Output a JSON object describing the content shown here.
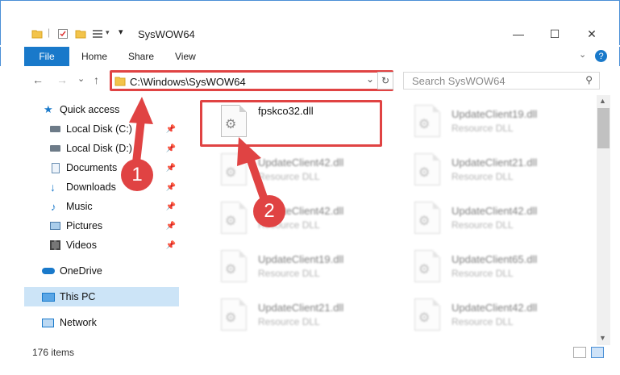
{
  "window": {
    "title": "SysWOW64"
  },
  "window_controls": {
    "minimize": "—",
    "maximize": "☐",
    "close": "✕"
  },
  "ribbon": {
    "file_label": "File",
    "tabs": [
      "Home",
      "Share",
      "View"
    ]
  },
  "navigation": {
    "back": "←",
    "forward": "→",
    "recent": "⌄",
    "up": "↑"
  },
  "address": {
    "path": "C:\\Windows\\SysWOW64"
  },
  "search": {
    "placeholder": "Search SysWOW64"
  },
  "sidebar": {
    "items": [
      {
        "label": "Quick access",
        "icon": "star-icon"
      },
      {
        "label": "Local Disk (C:)",
        "icon": "drive-icon",
        "pinned": true
      },
      {
        "label": "Local Disk (D:)",
        "icon": "drive-icon",
        "pinned": true
      },
      {
        "label": "Documents",
        "icon": "documents-icon",
        "pinned": true
      },
      {
        "label": "Downloads",
        "icon": "download-icon",
        "pinned": true
      },
      {
        "label": "Music",
        "icon": "music-icon",
        "pinned": true
      },
      {
        "label": "Pictures",
        "icon": "pictures-icon",
        "pinned": true
      },
      {
        "label": "Videos",
        "icon": "videos-icon",
        "pinned": true
      },
      {
        "label": "OneDrive",
        "icon": "cloud-icon"
      },
      {
        "label": "This PC",
        "icon": "computer-icon",
        "selected": true
      },
      {
        "label": "Network",
        "icon": "network-icon"
      }
    ]
  },
  "files": {
    "highlighted": {
      "name": "fpskco32.dll"
    },
    "left_column": [
      {
        "name": "UpdateClient42.dll",
        "type": "Resource DLL"
      },
      {
        "name": "UpdateClient42.dll",
        "type": "Resource DLL"
      },
      {
        "name": "UpdateClient19.dll",
        "type": "Resource DLL"
      },
      {
        "name": "UpdateClient21.dll",
        "type": "Resource DLL"
      }
    ],
    "right_column": [
      {
        "name": "UpdateClient19.dll",
        "type": "Resource DLL"
      },
      {
        "name": "UpdateClient21.dll",
        "type": "Resource DLL"
      },
      {
        "name": "UpdateClient42.dll",
        "type": "Resource DLL"
      },
      {
        "name": "UpdateClient65.dll",
        "type": "Resource DLL"
      },
      {
        "name": "UpdateClient42.dll",
        "type": "Resource DLL"
      }
    ]
  },
  "status": {
    "item_count": "176 items"
  },
  "annotations": {
    "step1": "1",
    "step2": "2"
  },
  "colors": {
    "highlight": "#e04343",
    "file_tab": "#1979ca",
    "selection": "#cce4f7"
  }
}
